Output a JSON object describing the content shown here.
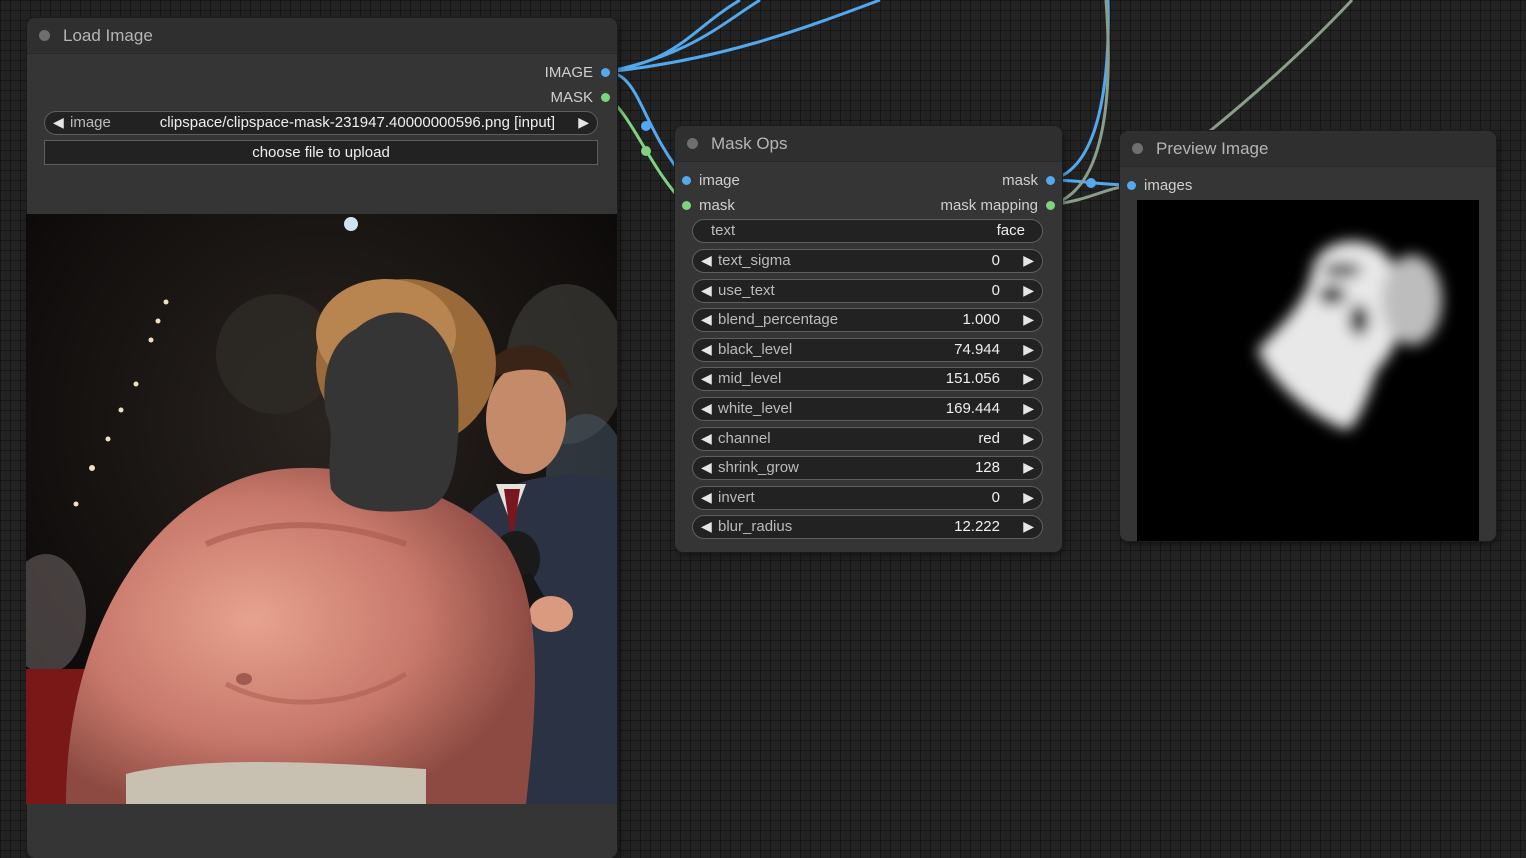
{
  "load_image": {
    "title": "Load Image",
    "outputs": [
      "IMAGE",
      "MASK"
    ],
    "image_widget": {
      "label": "image",
      "value": "clipspace/clipspace-mask-231947.40000000596.png [input]"
    },
    "upload_label": "choose file to upload"
  },
  "mask_ops": {
    "title": "Mask Ops",
    "inputs": [
      "image",
      "mask"
    ],
    "outputs": [
      "mask",
      "mask mapping"
    ],
    "text_widget": {
      "label": "text",
      "value": "face"
    },
    "widgets": [
      {
        "label": "text_sigma",
        "value": "0"
      },
      {
        "label": "use_text",
        "value": "0"
      },
      {
        "label": "blend_percentage",
        "value": "1.000"
      },
      {
        "label": "black_level",
        "value": "74.944"
      },
      {
        "label": "mid_level",
        "value": "151.056"
      },
      {
        "label": "white_level",
        "value": "169.444"
      },
      {
        "label": "channel",
        "value": "red"
      },
      {
        "label": "shrink_grow",
        "value": "128"
      },
      {
        "label": "invert",
        "value": "0"
      },
      {
        "label": "blur_radius",
        "value": "12.222"
      }
    ]
  },
  "preview_image": {
    "title": "Preview Image",
    "inputs": [
      "images"
    ]
  },
  "colors": {
    "image_link": "#54a8ee",
    "mask_link": "#7fd27f",
    "mapping_link": "#8a9e8a",
    "canvas_bg": "#232323",
    "node_bg": "#353535"
  },
  "icons": {
    "arrow_left": "◀",
    "arrow_right": "▶"
  }
}
